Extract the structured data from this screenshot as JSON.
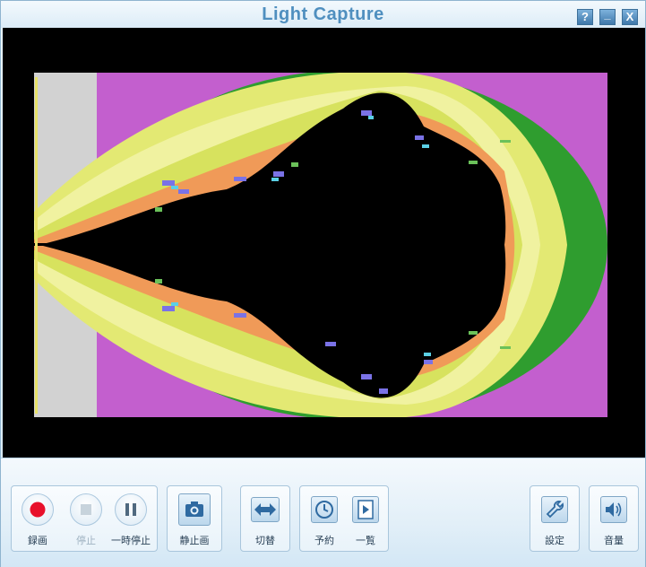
{
  "window": {
    "title": "Light Capture",
    "help_label": "?",
    "minimize_label": "_",
    "close_label": "X"
  },
  "controls": {
    "record_label": "録画",
    "stop_label": "停止",
    "pause_label": "一時停止",
    "snapshot_label": "静止画",
    "switch_label": "切替",
    "schedule_label": "予約",
    "list_label": "一覧",
    "settings_label": "設定",
    "volume_label": "音量"
  },
  "colors": {
    "accent": "#4f8fbf",
    "record_red": "#e8102a",
    "icon_blue": "#2f6aa1"
  }
}
